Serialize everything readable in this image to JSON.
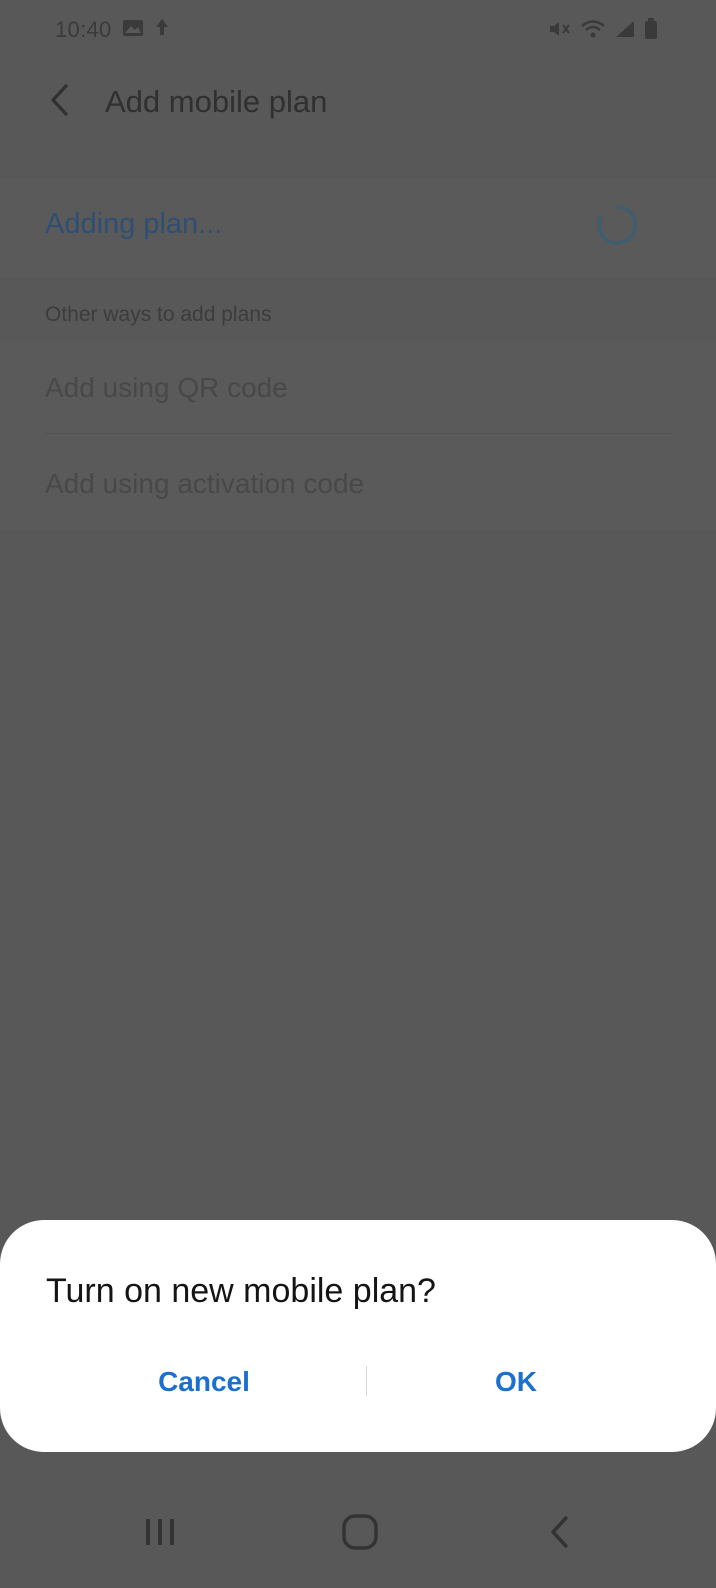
{
  "status_bar": {
    "time": "10:40",
    "left_icons": [
      "image-icon",
      "upload-icon"
    ],
    "right_icons": [
      "mute-icon",
      "wifi-icon",
      "signal-icon",
      "battery-icon"
    ]
  },
  "app_bar": {
    "title": "Add mobile plan",
    "back_icon": "chevron-left-icon"
  },
  "main": {
    "status_label": "Adding plan...",
    "section_header": "Other ways to add plans",
    "options": [
      {
        "label": "Add using QR code"
      },
      {
        "label": "Add using activation code"
      }
    ]
  },
  "dialog": {
    "title": "Turn on new mobile plan?",
    "cancel_label": "Cancel",
    "ok_label": "OK"
  },
  "nav_bar": {
    "icons": [
      "recents-icon",
      "home-icon",
      "back-icon"
    ]
  },
  "colors": {
    "accent": "#1a6fcf",
    "scrim_background": "#585858",
    "dialog_background": "#ffffff"
  }
}
